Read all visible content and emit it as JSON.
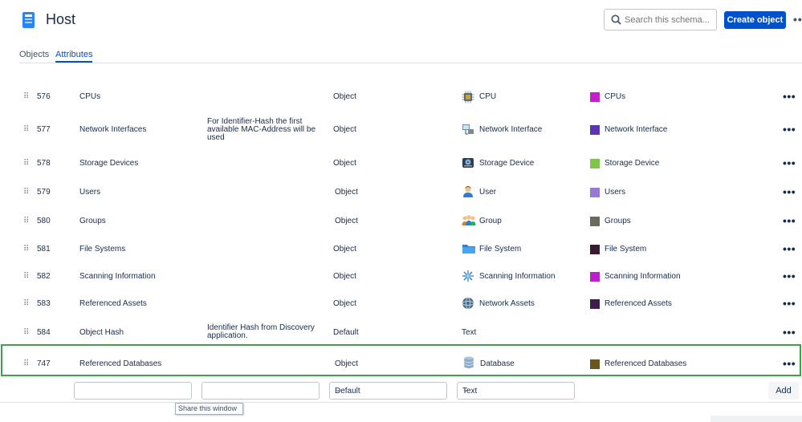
{
  "header": {
    "title": "Host",
    "search_placeholder": "Search this schema...",
    "create_button": "Create object",
    "more": "•••"
  },
  "tabs": [
    {
      "label": "Objects",
      "active": false
    },
    {
      "label": "Attributes",
      "active": true
    }
  ],
  "rows": [
    {
      "id": "576",
      "name": "CPUs",
      "description": "",
      "type": "Object",
      "object_type": "CPU",
      "object_icon": "chip-icon",
      "reference": "CPUs",
      "ref_color": "#c41ecf"
    },
    {
      "id": "577",
      "name": "Network Interfaces",
      "description": "For Identifier-Hash the first available MAC-Address will be used",
      "type": "Object",
      "object_type": "Network Interface",
      "object_icon": "network-interface-icon",
      "reference": "Network Interface",
      "ref_color": "#5b35b5"
    },
    {
      "id": "578",
      "name": "Storage Devices",
      "description": "",
      "type": "Object",
      "object_type": "Storage Device",
      "object_icon": "storage-device-icon",
      "reference": "Storage Device",
      "ref_color": "#7fc54a"
    },
    {
      "id": "579",
      "name": "Users",
      "description": "",
      "type": "Object",
      "object_type": "User",
      "object_icon": "user-icon",
      "reference": "Users",
      "ref_color": "#9a79d6"
    },
    {
      "id": "580",
      "name": "Groups",
      "description": "",
      "type": "Object",
      "object_type": "Group",
      "object_icon": "group-icon",
      "reference": "Groups",
      "ref_color": "#6b6a5e"
    },
    {
      "id": "581",
      "name": "File Systems",
      "description": "",
      "type": "Object",
      "object_type": "File System",
      "object_icon": "folder-icon",
      "reference": "File System",
      "ref_color": "#3a1b32"
    },
    {
      "id": "582",
      "name": "Scanning Information",
      "description": "",
      "type": "Object",
      "object_type": "Scanning Information",
      "object_icon": "scan-icon",
      "reference": "Scanning Information",
      "ref_color": "#c01ccc"
    },
    {
      "id": "583",
      "name": "Referenced Assets",
      "description": "",
      "type": "Object",
      "object_type": "Network Assets",
      "object_icon": "network-assets-icon",
      "reference": "Referenced Assets",
      "ref_color": "#3d1d4e"
    },
    {
      "id": "584",
      "name": "Object Hash",
      "description": "Identifier Hash from Discovery application.",
      "type": "Default",
      "object_type": "Text",
      "object_icon": "",
      "reference": "",
      "ref_color": ""
    },
    {
      "id": "747",
      "name": "Referenced Databases",
      "description": "",
      "type": "Object",
      "object_type": "Database",
      "object_icon": "database-icon",
      "reference": "Referenced Databases",
      "ref_color": "#6b5420"
    }
  ],
  "add_row": {
    "type_select": "Default",
    "value_select": "Text",
    "add_button": "Add"
  },
  "tooltip": "Share this window"
}
